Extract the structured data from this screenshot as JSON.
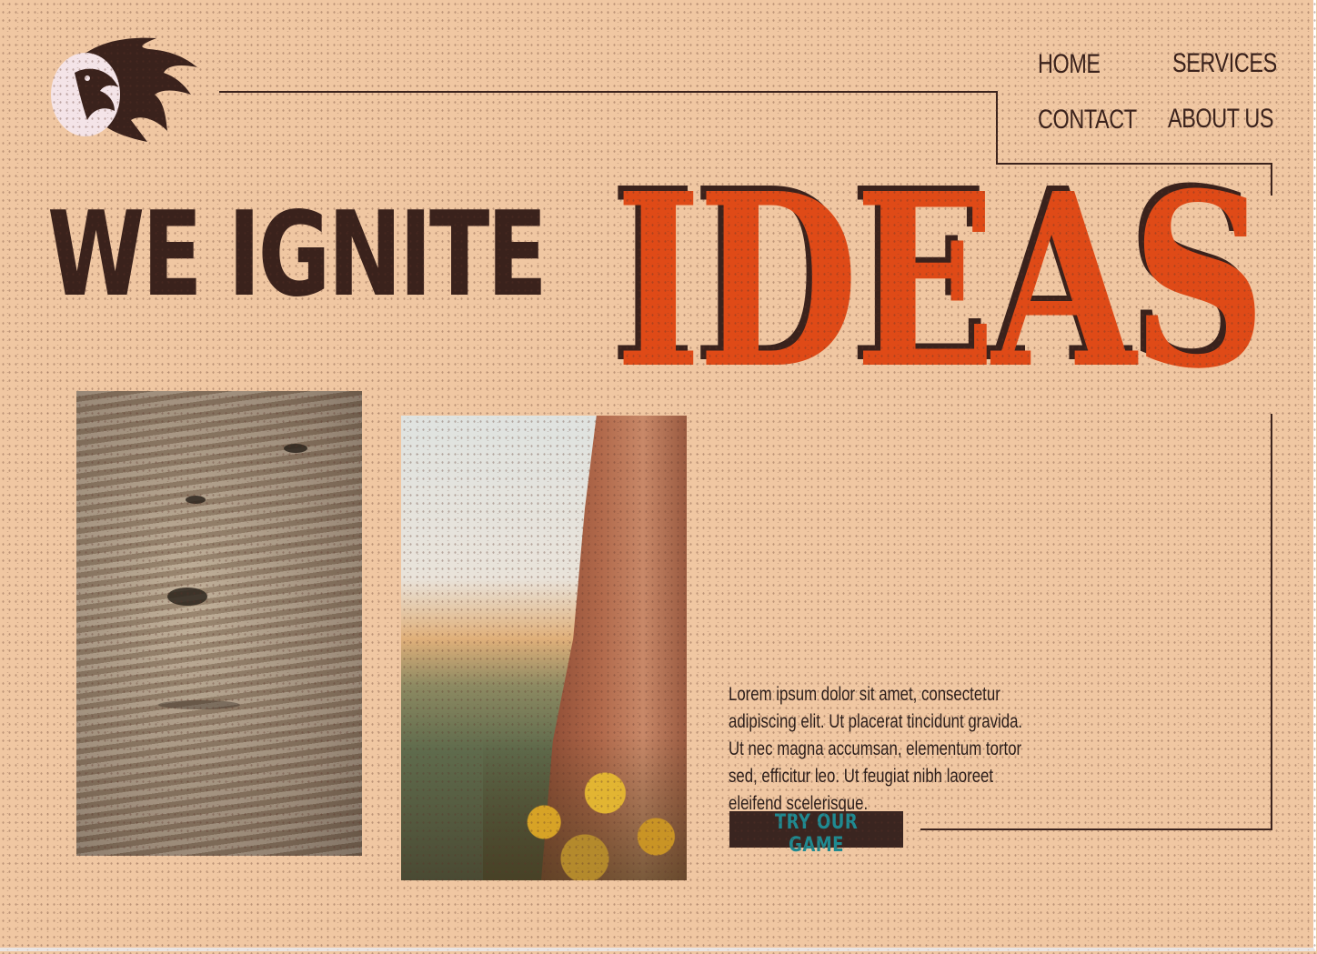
{
  "nav": {
    "home": "HOME",
    "services": "SERVICES",
    "contact": "CONTACT",
    "about": "ABOUT US"
  },
  "hero": {
    "headline_part1": "WE IGNITE",
    "headline_part2": "IDEAS"
  },
  "content": {
    "paragraph": "Lorem ipsum dolor sit amet, consectetur adipiscing elit. Ut placerat tincidunt gravida. Ut nec magna accumsan, elementum tortor sed, efficitur leo. Ut feugiat nibh laoreet eleifend scelerisque.",
    "cta_label": "TRY OUR GAME"
  },
  "colors": {
    "background": "#f0c7a2",
    "dark": "#3a221c",
    "accent": "#df4a17",
    "cta_text": "#1f8a91"
  },
  "icons": {
    "logo": "flaming-face-logo"
  }
}
